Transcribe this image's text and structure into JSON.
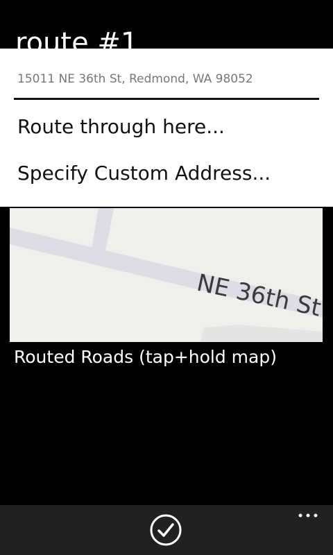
{
  "page": {
    "title": "route #1"
  },
  "context_menu": {
    "address": "15011 NE 36th St, Redmond, WA 98052",
    "items": [
      {
        "label": "Route through here..."
      },
      {
        "label": "Specify Custom Address..."
      }
    ]
  },
  "map": {
    "street_label": "NE 36th St",
    "caption": "Routed Roads (tap+hold map)"
  },
  "app_bar": {
    "check_icon": "check-icon",
    "more_icon": "ellipsis-icon"
  },
  "colors": {
    "background": "#000000",
    "popup": "#ffffff",
    "map_bg": "#f0efeb",
    "road": "#dcdde5",
    "app_bar": "#212121"
  }
}
